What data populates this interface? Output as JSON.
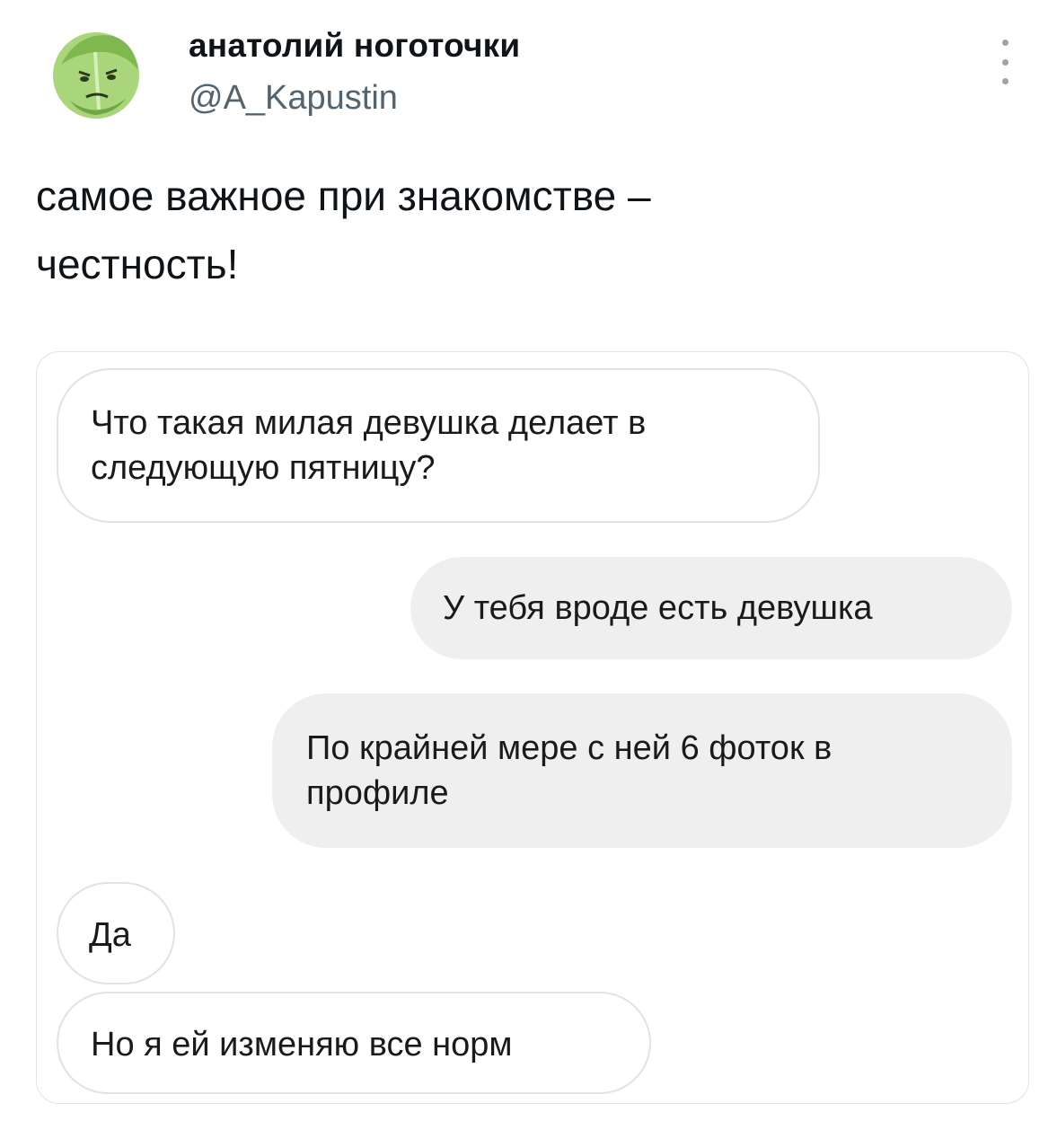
{
  "tweet": {
    "author": {
      "display_name": "анатолий ноготочки",
      "handle": "@A_Kapustin",
      "avatar_icon": "cabbage-face-icon"
    },
    "more_icon": "more-vertical-icon",
    "text": "самое важное при знакомстве –\nчестность!"
  },
  "chat": {
    "messages": [
      {
        "side": "in",
        "text": "Что такая милая девушка делает в следующую пятницу?"
      },
      {
        "side": "out",
        "text": "У тебя вроде есть девушка"
      },
      {
        "side": "out",
        "text": "По крайней мере с ней 6 фоток в профиле"
      },
      {
        "side": "in",
        "text": "Да"
      },
      {
        "side": "in",
        "text": "Но я ей изменяю все норм"
      }
    ]
  },
  "colors": {
    "name": "#0f1419",
    "handle": "#536471",
    "incoming_bubble_border": "#e2e2e2",
    "outgoing_bubble_bg": "#efefef",
    "cabbage_green": "#8fc45a"
  }
}
